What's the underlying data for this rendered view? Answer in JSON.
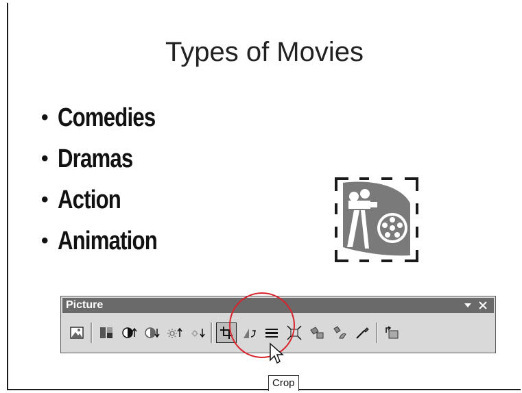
{
  "slide": {
    "title": "Types of Movies",
    "bullets": [
      "Comedies",
      "Dramas",
      "Action",
      "Animation"
    ],
    "bullet_glyph": "•",
    "clipart_icon": "film-camera-reel-clipart"
  },
  "toolbar": {
    "title": "Picture",
    "close_glyph": "×",
    "menu_glyph": "▼",
    "buttons": [
      {
        "name": "insert-picture"
      },
      {
        "name": "color"
      },
      {
        "name": "more-contrast"
      },
      {
        "name": "less-contrast"
      },
      {
        "name": "more-brightness"
      },
      {
        "name": "less-brightness"
      },
      {
        "name": "crop",
        "active": true
      },
      {
        "name": "rotate-left"
      },
      {
        "name": "line-style"
      },
      {
        "name": "compress-pictures"
      },
      {
        "name": "recolor-picture"
      },
      {
        "name": "format-picture"
      },
      {
        "name": "set-transparent-color"
      },
      {
        "name": "reset-picture"
      }
    ]
  },
  "tooltip": "Crop",
  "colors": {
    "highlight": "#d8242c",
    "toolbar_title_bg": "#6a6a6a",
    "toolbar_bg": "#d9d9d9"
  }
}
